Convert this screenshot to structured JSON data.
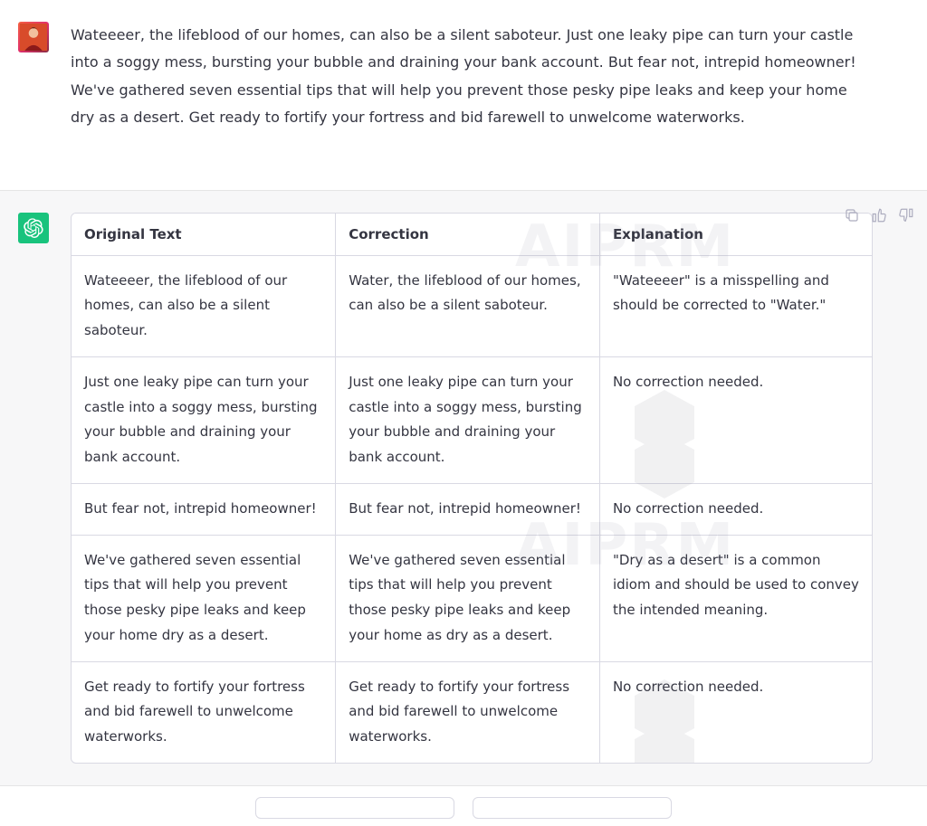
{
  "user_message": "Wateeeer, the lifeblood of our homes, can also be a silent saboteur. Just one leaky pipe can turn your castle into a soggy mess, bursting your bubble and draining your bank account. But fear not, intrepid homeowner! We've gathered seven essential tips that will help you prevent those pesky pipe leaks and keep your home dry as a desert. Get ready to fortify your fortress and bid farewell to unwelcome waterworks.",
  "table": {
    "headers": [
      "Original Text",
      "Correction",
      "Explanation"
    ],
    "rows": [
      {
        "original": "Wateeeer, the lifeblood of our homes, can also be a silent saboteur.",
        "correction": "Water, the lifeblood of our homes, can also be a silent saboteur.",
        "explanation": "\"Wateeeer\" is a misspelling and should be corrected to \"Water.\""
      },
      {
        "original": "Just one leaky pipe can turn your castle into a soggy mess, bursting your bubble and draining your bank account.",
        "correction": "Just one leaky pipe can turn your castle into a soggy mess, bursting your bubble and draining your bank account.",
        "explanation": "No correction needed."
      },
      {
        "original": "But fear not, intrepid homeowner!",
        "correction": "But fear not, intrepid homeowner!",
        "explanation": "No correction needed."
      },
      {
        "original": "We've gathered seven essential tips that will help you prevent those pesky pipe leaks and keep your home dry as a desert.",
        "correction": "We've gathered seven essential tips that will help you prevent those pesky pipe leaks and keep your home as dry as a desert.",
        "explanation": "\"Dry as a desert\" is a common idiom and should be used to convey the intended meaning."
      },
      {
        "original": "Get ready to fortify your fortress and bid farewell to unwelcome waterworks.",
        "correction": "Get ready to fortify your fortress and bid farewell to unwelcome waterworks.",
        "explanation": "No correction needed."
      }
    ]
  },
  "watermark_text": "AIPRM"
}
